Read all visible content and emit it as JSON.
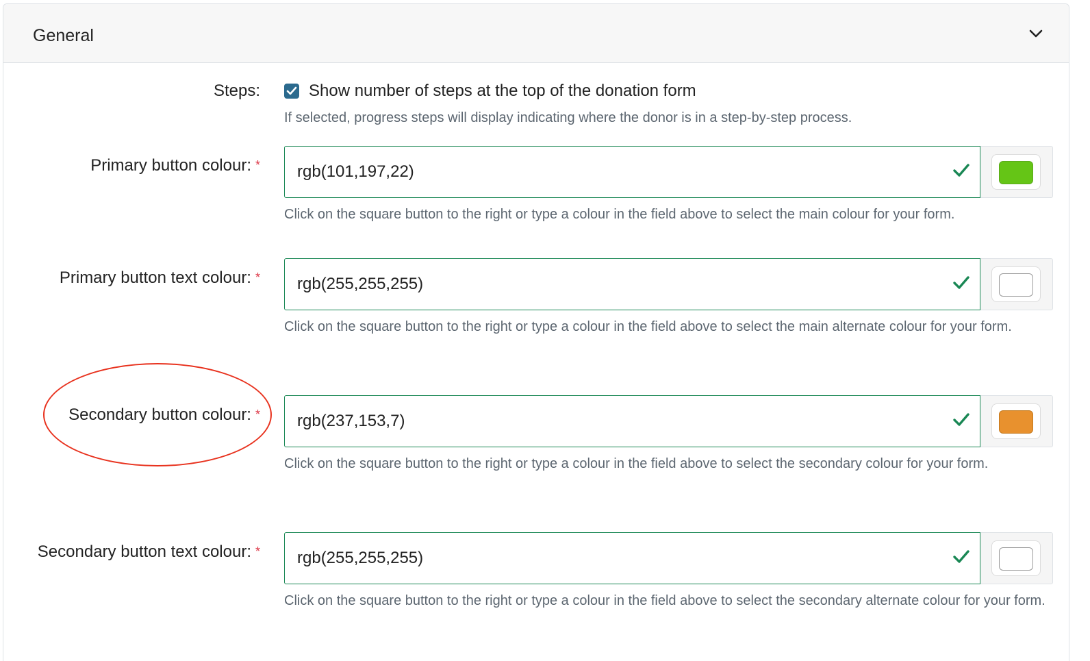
{
  "panel": {
    "title": "General"
  },
  "steps": {
    "label": "Steps:",
    "checked": true,
    "checkbox_label": "Show number of steps at the top of the donation form",
    "help": "If selected, progress steps will display indicating where the donor is in a step-by-step process."
  },
  "fields": [
    {
      "label": "Primary button colour:",
      "required_mark": "*",
      "value": "rgb(101,197,22)",
      "swatch_color": "#65c516",
      "help": "Click on the square button to the right or type a colour in the field above to select the main colour for your form."
    },
    {
      "label": "Primary button text colour:",
      "required_mark": "*",
      "value": "rgb(255,255,255)",
      "swatch_color": "#ffffff",
      "help": "Click on the square button to the right or type a colour in the field above to select the main alternate colour for your form."
    },
    {
      "label": "Secondary button colour:",
      "required_mark": "*",
      "value": "rgb(237,153,7)",
      "swatch_color": "#ed9907",
      "help": "Click on the square button to the right or type a colour in the field above to select the secondary colour for your form."
    },
    {
      "label": "Secondary button text colour:",
      "required_mark": "*",
      "value": "rgb(255,255,255)",
      "swatch_color": "#ffffff",
      "help": "Click on the square button to the right or type a colour in the field above to select the secondary alternate colour for your form."
    }
  ],
  "colors": {
    "valid": "#198754",
    "required": "#dc3545",
    "checkbox": "#2b6a8e",
    "annotation": "#e8321e"
  }
}
